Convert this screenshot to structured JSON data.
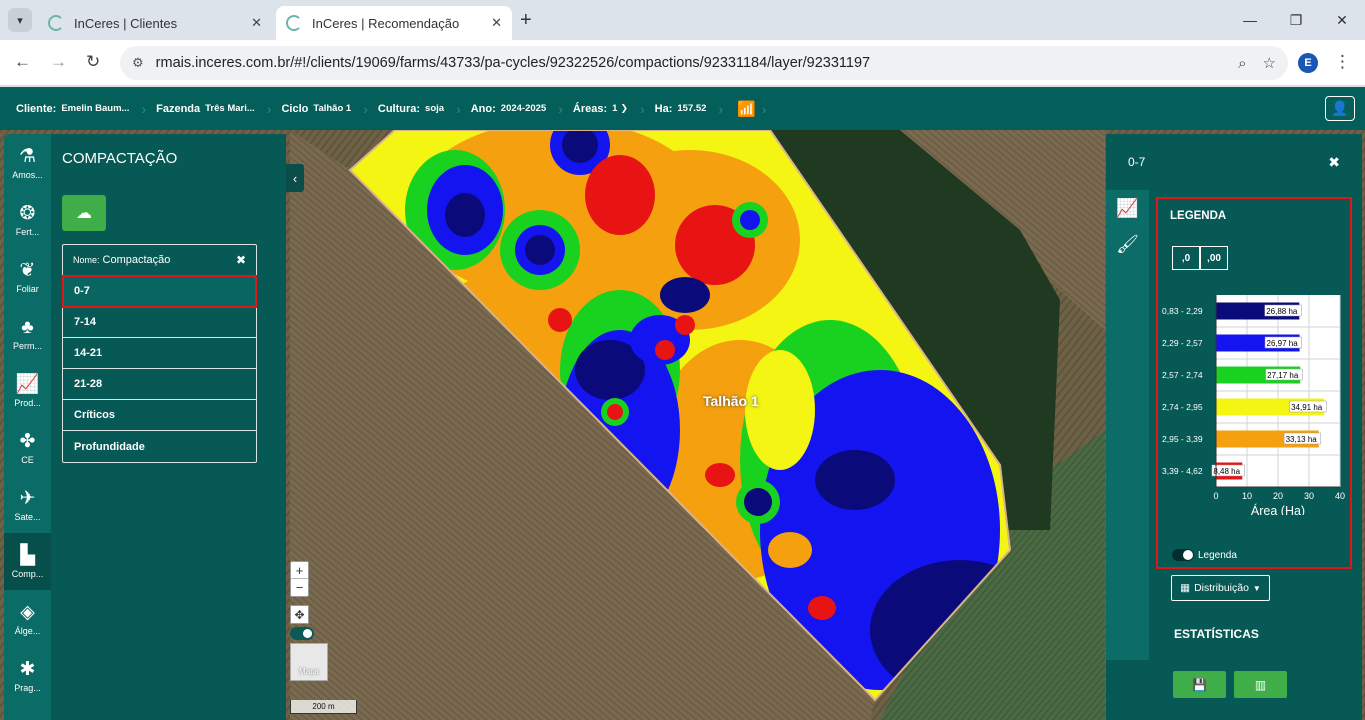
{
  "browser": {
    "tabs": [
      {
        "title": "InCeres | Clientes",
        "active": false
      },
      {
        "title": "InCeres | Recomendação",
        "active": true
      }
    ],
    "url": "rmais.inceres.com.br/#!/clients/19069/farms/43733/pa-cycles/92322526/compactions/92331184/layer/92331197",
    "profile_initial": "E"
  },
  "header": {
    "cliente_label": "Cliente:",
    "cliente_value": "Emelin Baum...",
    "fazenda_label": "Fazenda",
    "fazenda_value": "Três Mari...",
    "ciclo_label": "Ciclo",
    "ciclo_value": "Talhão 1",
    "cultura_label": "Cultura:",
    "cultura_value": "soja",
    "ano_label": "Ano:",
    "ano_value": "2024-2025",
    "areas_label": "Áreas:",
    "areas_value": "1",
    "ha_label": "Ha:",
    "ha_value": "157.52"
  },
  "rail": [
    {
      "label": "Amos...",
      "icon": "sampling-icon"
    },
    {
      "label": "Fert...",
      "icon": "fertilizer-icon"
    },
    {
      "label": "Foliar",
      "icon": "leaf-icon"
    },
    {
      "label": "Perm...",
      "icon": "permanent-crop-icon"
    },
    {
      "label": "Prod...",
      "icon": "productivity-icon"
    },
    {
      "label": "CE",
      "icon": "plant-icon"
    },
    {
      "label": "Sate...",
      "icon": "satellite-icon"
    },
    {
      "label": "Comp...",
      "icon": "compaction-icon"
    },
    {
      "label": "Álge...",
      "icon": "layers-icon"
    },
    {
      "label": "Prag...",
      "icon": "bug-icon"
    }
  ],
  "left_panel": {
    "title": "COMPACTAÇÃO",
    "name_label": "Nome:",
    "name_value": "Compactação",
    "layers": [
      "0-7",
      "7-14",
      "14-21",
      "21-28",
      "Críticos",
      "Profundidade"
    ]
  },
  "map": {
    "field_label": "Talhão 1",
    "scale": "200 m",
    "basemap_label": "Mapa"
  },
  "right_panel": {
    "title": "0-7",
    "legend_title": "LEGENDA",
    "dec_minus": ",0",
    "dec_plus": ",00",
    "legend_toggle": "Legenda",
    "distribution_label": "Distribuição",
    "stats_title": "ESTATÍSTICAS"
  },
  "chart_data": {
    "type": "bar",
    "orientation": "horizontal",
    "categories": [
      "0,83 - 2,29",
      "2,29 - 2,57",
      "2,57 - 2,74",
      "2,74 - 2,95",
      "2,95 - 3,39",
      "3,39 - 4,62"
    ],
    "values": [
      26.88,
      26.97,
      27.17,
      34.91,
      33.13,
      8.48
    ],
    "value_labels": [
      "26,88 ha",
      "26,97 ha",
      "27,17 ha",
      "34,91 ha",
      "33,13 ha",
      "8,48 ha"
    ],
    "colors": [
      "#0b0a7a",
      "#1414f0",
      "#19d11f",
      "#f5f514",
      "#f5a00f",
      "#e81414"
    ],
    "xlabel": "Área (Ha)",
    "xlim": [
      0,
      40
    ],
    "xticks": [
      "0",
      "10",
      "20",
      "30",
      "40"
    ],
    "grid": true
  }
}
